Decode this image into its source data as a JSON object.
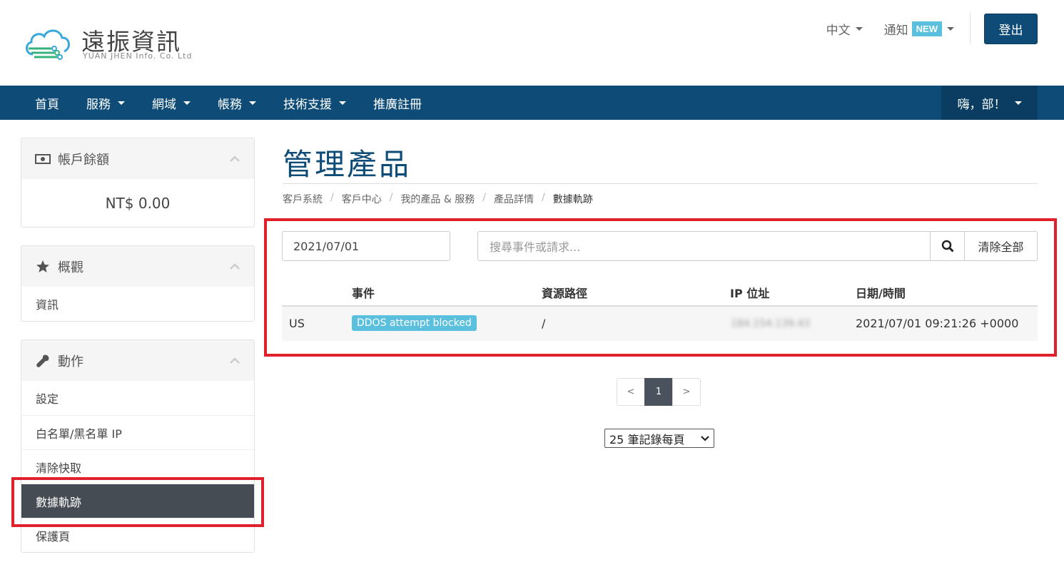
{
  "header": {
    "logo_main": "遠振資訊",
    "logo_sub": "YUAN JHEN Info. Co. Ltd",
    "language": "中文",
    "notifications": "通知",
    "new_badge": "NEW",
    "logout": "登出"
  },
  "nav": {
    "items": [
      {
        "label": "首頁",
        "dropdown": false
      },
      {
        "label": "服務",
        "dropdown": true
      },
      {
        "label": "網域",
        "dropdown": true
      },
      {
        "label": "帳務",
        "dropdown": true
      },
      {
        "label": "技術支援",
        "dropdown": true
      },
      {
        "label": "推廣註冊",
        "dropdown": false
      }
    ],
    "user": "嗨，部！"
  },
  "sidebar": {
    "balance": {
      "title": "帳戶餘額",
      "value": "NT$ 0.00"
    },
    "overview": {
      "title": "概觀",
      "links": [
        "資訊"
      ]
    },
    "actions": {
      "title": "動作",
      "links": [
        "設定",
        "白名單/黑名單 IP",
        "清除快取",
        "數據軌跡",
        "保護頁"
      ],
      "active": "數據軌跡"
    }
  },
  "main": {
    "title": "管理產品",
    "breadcrumb": [
      "客戶系統",
      "客戶中心",
      "我的產品 & 服務",
      "產品詳情",
      "數據軌跡"
    ],
    "date_filter": "2021/07/01",
    "search_placeholder": "搜尋事件或請求...",
    "clear_all": "清除全部",
    "table": {
      "headers": [
        "",
        "事件",
        "資源路徑",
        "IP 位址",
        "日期/時間"
      ],
      "rows": [
        {
          "country": "US",
          "event": "DDOS attempt blocked",
          "path": "/",
          "ip": "184.154.139.43",
          "datetime": "2021/07/01 09:21:26 +0000"
        }
      ]
    },
    "pagination": {
      "prev": "<",
      "current": "1",
      "next": ">"
    },
    "per_page": "25 筆記錄每頁"
  },
  "colors": {
    "brand": "#0e4c77",
    "badge": "#5bc0de",
    "highlight": "#e0202a",
    "active_item": "#464c53"
  }
}
